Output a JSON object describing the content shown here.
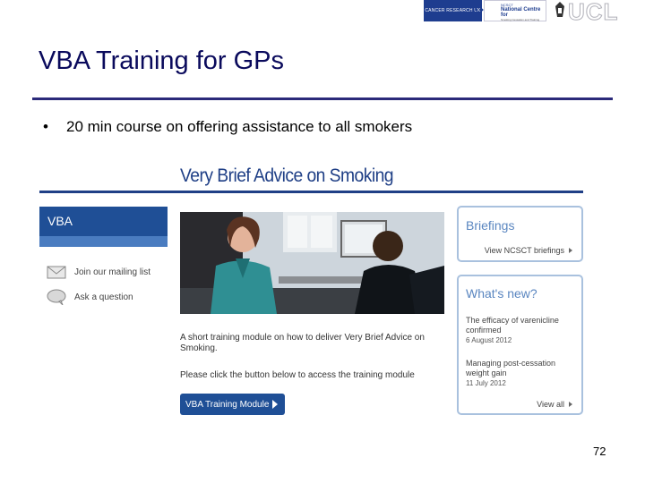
{
  "header": {
    "logo_cr": "CANCER RESEARCH UK",
    "logo_ncsct_line1": "NCSCT",
    "logo_ncsct_line2": "National Centre for",
    "logo_ncsct_line3": "Smoking Cessation and Training",
    "logo_ucl": "UCL"
  },
  "slide": {
    "title": "VBA Training for GPs",
    "bullet": "20 min course on offering assistance to all smokers",
    "bullet_symbol": "•",
    "page_number": "72"
  },
  "site": {
    "heading": "Very Brief Advice on Smoking",
    "nav_label": "VBA",
    "links": {
      "mailing": "Join our mailing list",
      "question": "Ask a question"
    },
    "description_1": "A short training module on how to deliver Very Brief Advice on Smoking.",
    "description_2": "Please click the button below to access the training module",
    "cta": "VBA Training Module",
    "briefings": {
      "title": "Briefings",
      "link": "View NCSCT briefings"
    },
    "whats_new": {
      "title": "What's new?",
      "items": [
        {
          "text": "The efficacy of varenicline confirmed",
          "date": "6 August 2012"
        },
        {
          "text": "Managing post-cessation weight gain",
          "date": "11 July 2012"
        }
      ],
      "view_all": "View all"
    }
  },
  "colors": {
    "title": "#0a0a5c",
    "rule": "#2b2a7a",
    "site_blue": "#1f4f96",
    "panel_border": "#a9c1de",
    "panel_title": "#5a86c0"
  }
}
